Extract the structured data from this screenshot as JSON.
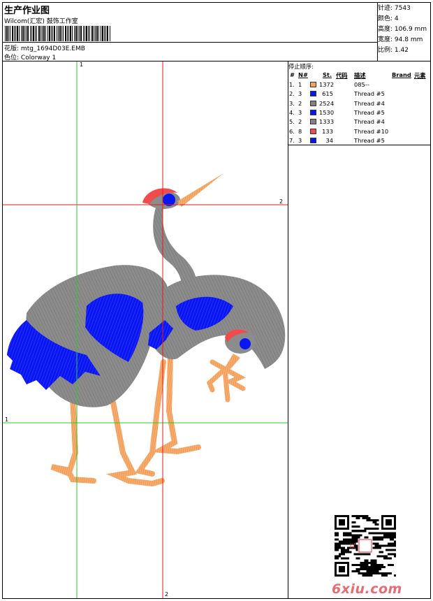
{
  "header": {
    "title": "生产作业图",
    "company": "Wilcom(汇宏) 鼓饰工作室",
    "design_label": "花版:",
    "design_value": "mtg_1694D03E.EMB",
    "colorway_label": "色位:",
    "colorway_value": "Colorway 1"
  },
  "stats": [
    {
      "label": "针迹:",
      "value": "7543"
    },
    {
      "label": "颜色:",
      "value": "4"
    },
    {
      "label": "高度:",
      "value": "106.9 mm"
    },
    {
      "label": "宽度:",
      "value": "94.8 mm"
    },
    {
      "label": "比例:",
      "value": "1.42"
    }
  ],
  "guides": {
    "h1": "2",
    "h2": "1",
    "v_top": "1",
    "v_bottom": "2"
  },
  "sequence": {
    "title": "停止顺序:",
    "headers": {
      "num": "#",
      "n": "N#",
      "st": "St.",
      "code": "代码",
      "desc": "描述",
      "brand": "Brand",
      "element": "元素"
    },
    "rows": [
      {
        "num": "1.",
        "n": "1",
        "color": "#f5a15d",
        "st": "1372",
        "desc": "085--"
      },
      {
        "num": "2.",
        "n": "3",
        "color": "#0a15f5",
        "st": "615",
        "desc": "Thread #5"
      },
      {
        "num": "3.",
        "n": "2",
        "color": "#828282",
        "st": "2524",
        "desc": "Thread #4"
      },
      {
        "num": "4.",
        "n": "3",
        "color": "#0a15f5",
        "st": "1530",
        "desc": "Thread #5"
      },
      {
        "num": "5.",
        "n": "2",
        "color": "#828282",
        "st": "1333",
        "desc": "Thread #4"
      },
      {
        "num": "6.",
        "n": "8",
        "color": "#f24b4b",
        "st": "133",
        "desc": "Thread #10"
      },
      {
        "num": "7.",
        "n": "3",
        "color": "#0a15f5",
        "st": "34",
        "desc": "Thread #5"
      }
    ]
  },
  "watermark": "6xiu.com",
  "stamp_text": "以    "
}
